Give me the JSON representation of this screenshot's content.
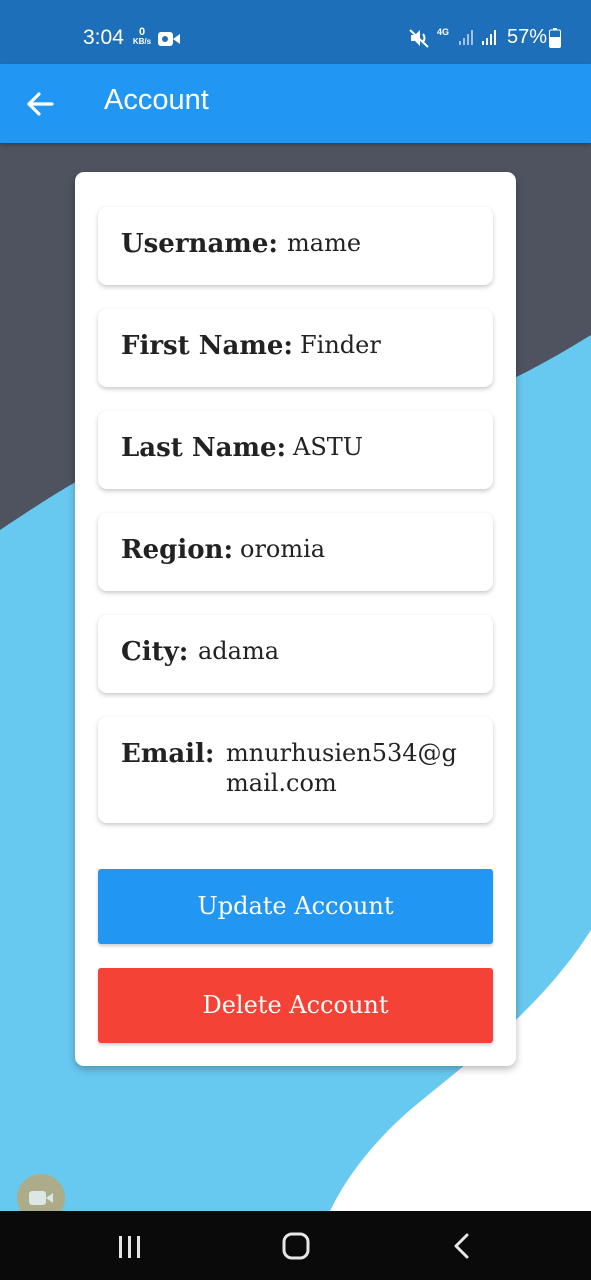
{
  "status_bar": {
    "time": "3:04",
    "data_speed_value": "0",
    "data_speed_unit": "KB/s",
    "network": "4G",
    "battery_percent": "57%"
  },
  "app_bar": {
    "title": "Account",
    "back_icon": "arrow-left-icon"
  },
  "account": {
    "fields": [
      {
        "label": "Username:",
        "value": "mame"
      },
      {
        "label": "First Name:",
        "value": "Finder"
      },
      {
        "label": "Last Name:",
        "value": "ASTU"
      },
      {
        "label": "Region:",
        "value": "oromia"
      },
      {
        "label": "City:",
        "value": "adama"
      },
      {
        "label": "Email:",
        "value_line1": "mnurhusien534@g",
        "value_line2": "mail.com"
      }
    ],
    "update_label": "Update Account",
    "delete_label": "Delete Account"
  },
  "colors": {
    "status_bar": "#1e6fba",
    "app_bar": "#2196f3",
    "background_dark": "#4f5360",
    "background_wave": "#68c9f0",
    "update_button": "#2196f3",
    "delete_button": "#f44336"
  },
  "nav_bar": {
    "recents_icon": "recents-icon",
    "home_icon": "home-icon",
    "back_icon": "back-chevron-icon"
  }
}
